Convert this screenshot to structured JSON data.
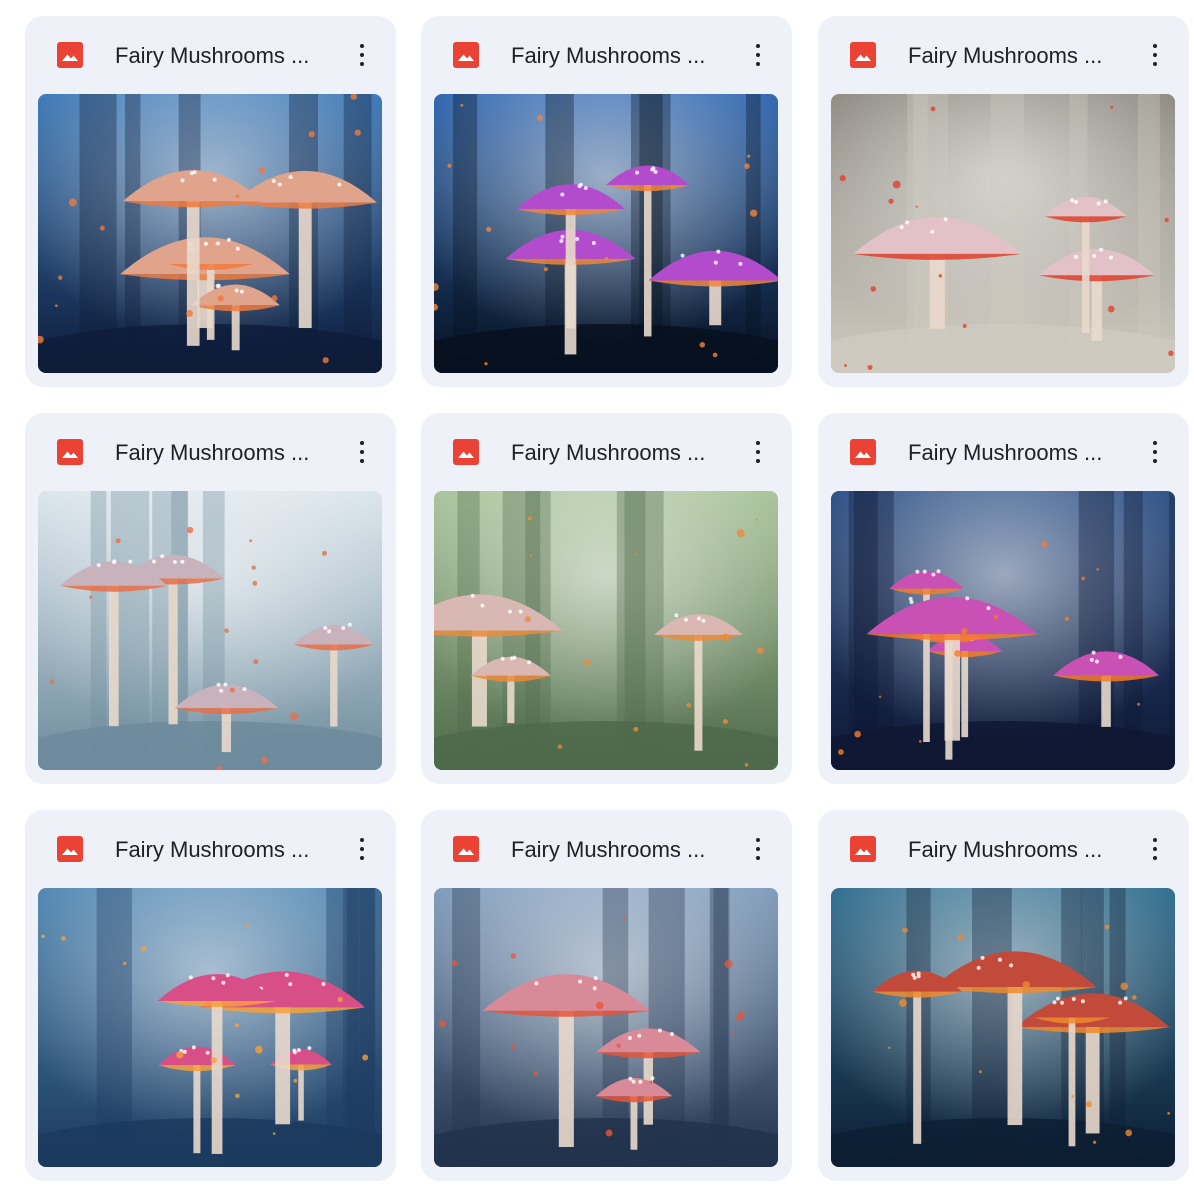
{
  "files": [
    {
      "name": "Fairy Mushrooms ...",
      "icon": "image-file-icon",
      "menu_icon": "more-vert-icon",
      "palette": [
        "#0e1c3a",
        "#3b78b6",
        "#e0a48c",
        "#f07a3c"
      ]
    },
    {
      "name": "Fairy Mushrooms ...",
      "icon": "image-file-icon",
      "menu_icon": "more-vert-icon",
      "palette": [
        "#07101f",
        "#2e66b0",
        "#b24ccd",
        "#f0863a"
      ]
    },
    {
      "name": "Fairy Mushrooms ...",
      "icon": "image-file-icon",
      "menu_icon": "more-vert-icon",
      "palette": [
        "#cfcac0",
        "#8e8a82",
        "#e3c2c7",
        "#e2402a"
      ]
    },
    {
      "name": "Fairy Mushrooms ...",
      "icon": "image-file-icon",
      "menu_icon": "more-vert-icon",
      "palette": [
        "#6d8b9c",
        "#dbe5ec",
        "#c8b3bd",
        "#e86f48"
      ]
    },
    {
      "name": "Fairy Mushrooms ...",
      "icon": "image-file-icon",
      "menu_icon": "more-vert-icon",
      "palette": [
        "#4f6a4a",
        "#a9c39a",
        "#d9b7b2",
        "#ec8b3a"
      ]
    },
    {
      "name": "Fairy Mushrooms ...",
      "icon": "image-file-icon",
      "menu_icon": "more-vert-icon",
      "palette": [
        "#0f1833",
        "#2b4f86",
        "#c950b4",
        "#f57b2c"
      ]
    },
    {
      "name": "Fairy Mushrooms ...",
      "icon": "image-file-icon",
      "menu_icon": "more-vert-icon",
      "palette": [
        "#1c3a5e",
        "#4f86b2",
        "#d84f88",
        "#f5a03a"
      ]
    },
    {
      "name": "Fairy Mushrooms ...",
      "icon": "image-file-icon",
      "menu_icon": "more-vert-icon",
      "palette": [
        "#22334d",
        "#7f9bbb",
        "#d98a98",
        "#e8553a"
      ]
    },
    {
      "name": "Fairy Mushrooms ...",
      "icon": "image-file-icon",
      "menu_icon": "more-vert-icon",
      "palette": [
        "#0d1e33",
        "#2f6d8e",
        "#c24a3a",
        "#f08a2c"
      ]
    }
  ],
  "colors": {
    "card_bg": "#eef2f8",
    "icon_red": "#ea4335",
    "text": "#202124"
  }
}
